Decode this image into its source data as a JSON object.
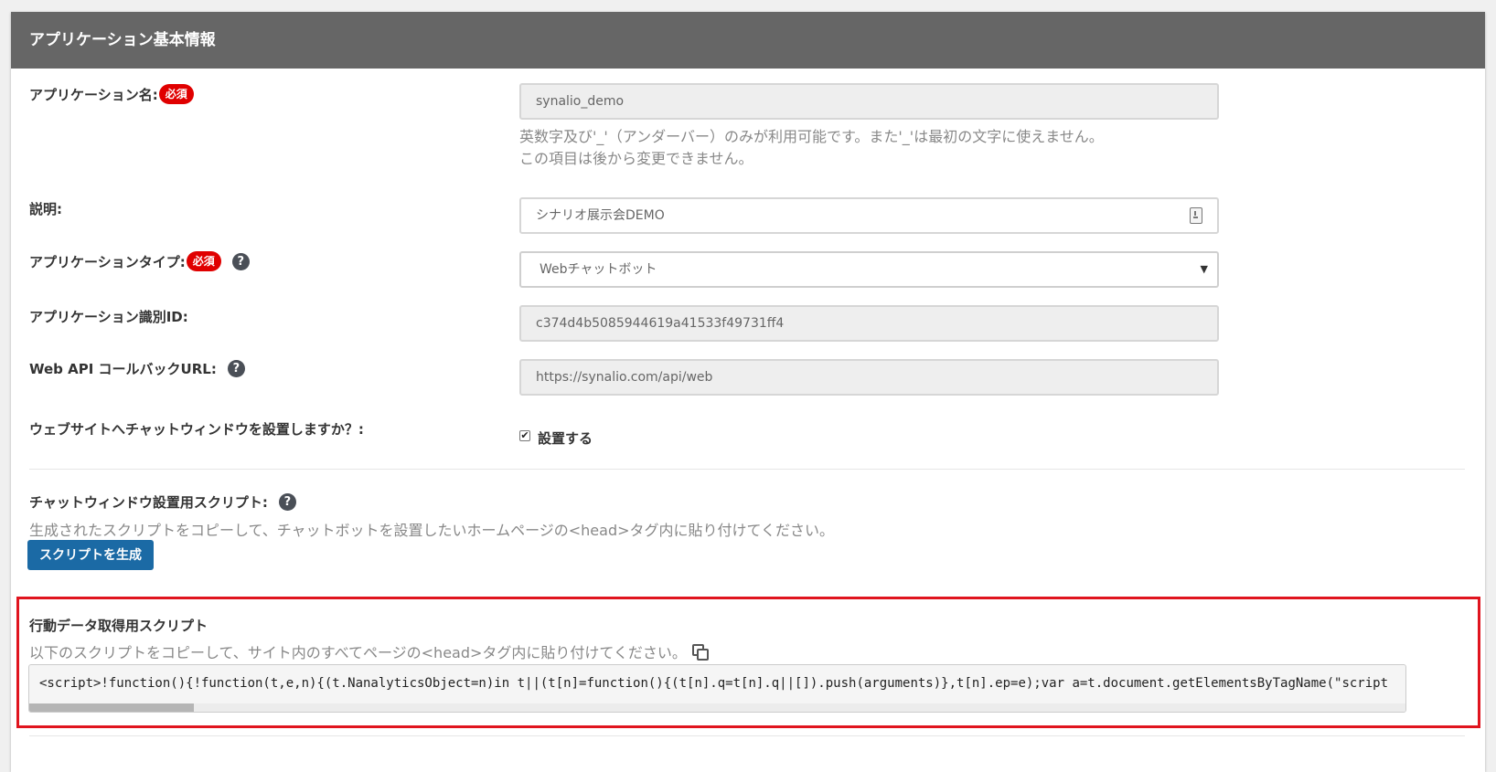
{
  "header": {
    "title": "アプリケーション基本情報"
  },
  "form": {
    "app_name": {
      "label": "アプリケーション名:",
      "badge": "必須",
      "value": "synalio_demo",
      "note_line1": "英数字及び'_'（アンダーバー）のみが利用可能です。また'_'は最初の文字に使えません。",
      "note_line2": "この項目は後から変更できません。"
    },
    "description": {
      "label": "説明:",
      "value": "シナリオ展示会DEMO"
    },
    "app_type": {
      "label": "アプリケーションタイプ:",
      "badge": "必須",
      "help": "?",
      "value": "Webチャットボット",
      "arrow": "▼"
    },
    "app_id": {
      "label": "アプリケーション識別ID:",
      "value": "c374d4b5085944619a41533f49731ff4"
    },
    "callback": {
      "label": "Web API コールバックURL:",
      "help": "?",
      "value": "https://synalio.com/api/web"
    },
    "install_window": {
      "label": "ウェブサイトへチャットウィンドウを設置しますか？:",
      "checked": true,
      "check_mark": "✔",
      "check_label": "設置する"
    }
  },
  "chat_script": {
    "label": "チャットウィンドウ設置用スクリプト:",
    "help": "?",
    "description": "生成されたスクリプトをコピーして、チャットボットを設置したいホームページの<head>タグ内に貼り付けてください。",
    "button": "スクリプトを生成"
  },
  "behavior_script": {
    "title": "行動データ取得用スクリプト",
    "description": "以下のスクリプトをコピーして、サイト内のすべてページの<head>タグ内に貼り付けてください。",
    "code": "<script>!function(){!function(t,e,n){(t.NanalyticsObject=n)in t||(t[n]=function(){(t[n].q=t[n].q||[]).push(arguments)},t[n].ep=e);var a=t.document.getElementsByTagName(\"script"
  },
  "colors": {
    "header_bg": "#666666",
    "badge": "#e00000",
    "button": "#1b6aa5",
    "highlight_border": "#e0141e"
  }
}
